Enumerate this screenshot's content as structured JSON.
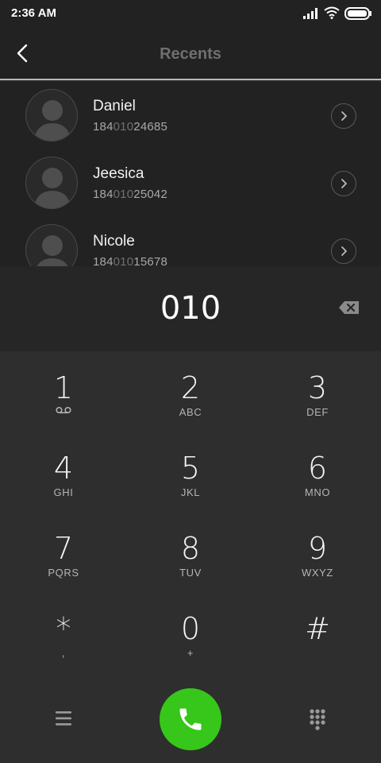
{
  "status_bar": {
    "time": "2:36 AM",
    "icons": [
      "signal-icon",
      "wifi-icon",
      "battery-icon"
    ]
  },
  "header": {
    "title": "Recents",
    "back_icon": "back-chevron-icon"
  },
  "contacts": [
    {
      "name": "Daniel",
      "number_prefix": "184",
      "number_match": "010",
      "number_suffix": "24685"
    },
    {
      "name": "Jeesica",
      "number_prefix": "184",
      "number_match": "010",
      "number_suffix": "25042"
    },
    {
      "name": "Nicole",
      "number_prefix": "184",
      "number_match": "010",
      "number_suffix": "15678"
    }
  ],
  "dialer": {
    "number": "010",
    "backspace_icon": "backspace-icon"
  },
  "keypad": [
    {
      "digit": "1",
      "letters": "",
      "sub_icon": "voicemail-icon"
    },
    {
      "digit": "2",
      "letters": "ABC"
    },
    {
      "digit": "3",
      "letters": "DEF"
    },
    {
      "digit": "4",
      "letters": "GHI"
    },
    {
      "digit": "5",
      "letters": "JKL"
    },
    {
      "digit": "6",
      "letters": "MNO"
    },
    {
      "digit": "7",
      "letters": "PQRS"
    },
    {
      "digit": "8",
      "letters": "TUV"
    },
    {
      "digit": "9",
      "letters": "WXYZ"
    },
    {
      "digit": "*",
      "letters": ","
    },
    {
      "digit": "0",
      "letters": "+"
    },
    {
      "digit": "#",
      "letters": ""
    }
  ],
  "bottom_bar": {
    "left_icon": "menu-icon",
    "call_icon": "phone-icon",
    "right_icon": "dialpad-icon"
  },
  "colors": {
    "background": "#2e2e2e",
    "list_background": "#222222",
    "call_button": "#36c71a",
    "header_title": "#6f6f6f"
  }
}
